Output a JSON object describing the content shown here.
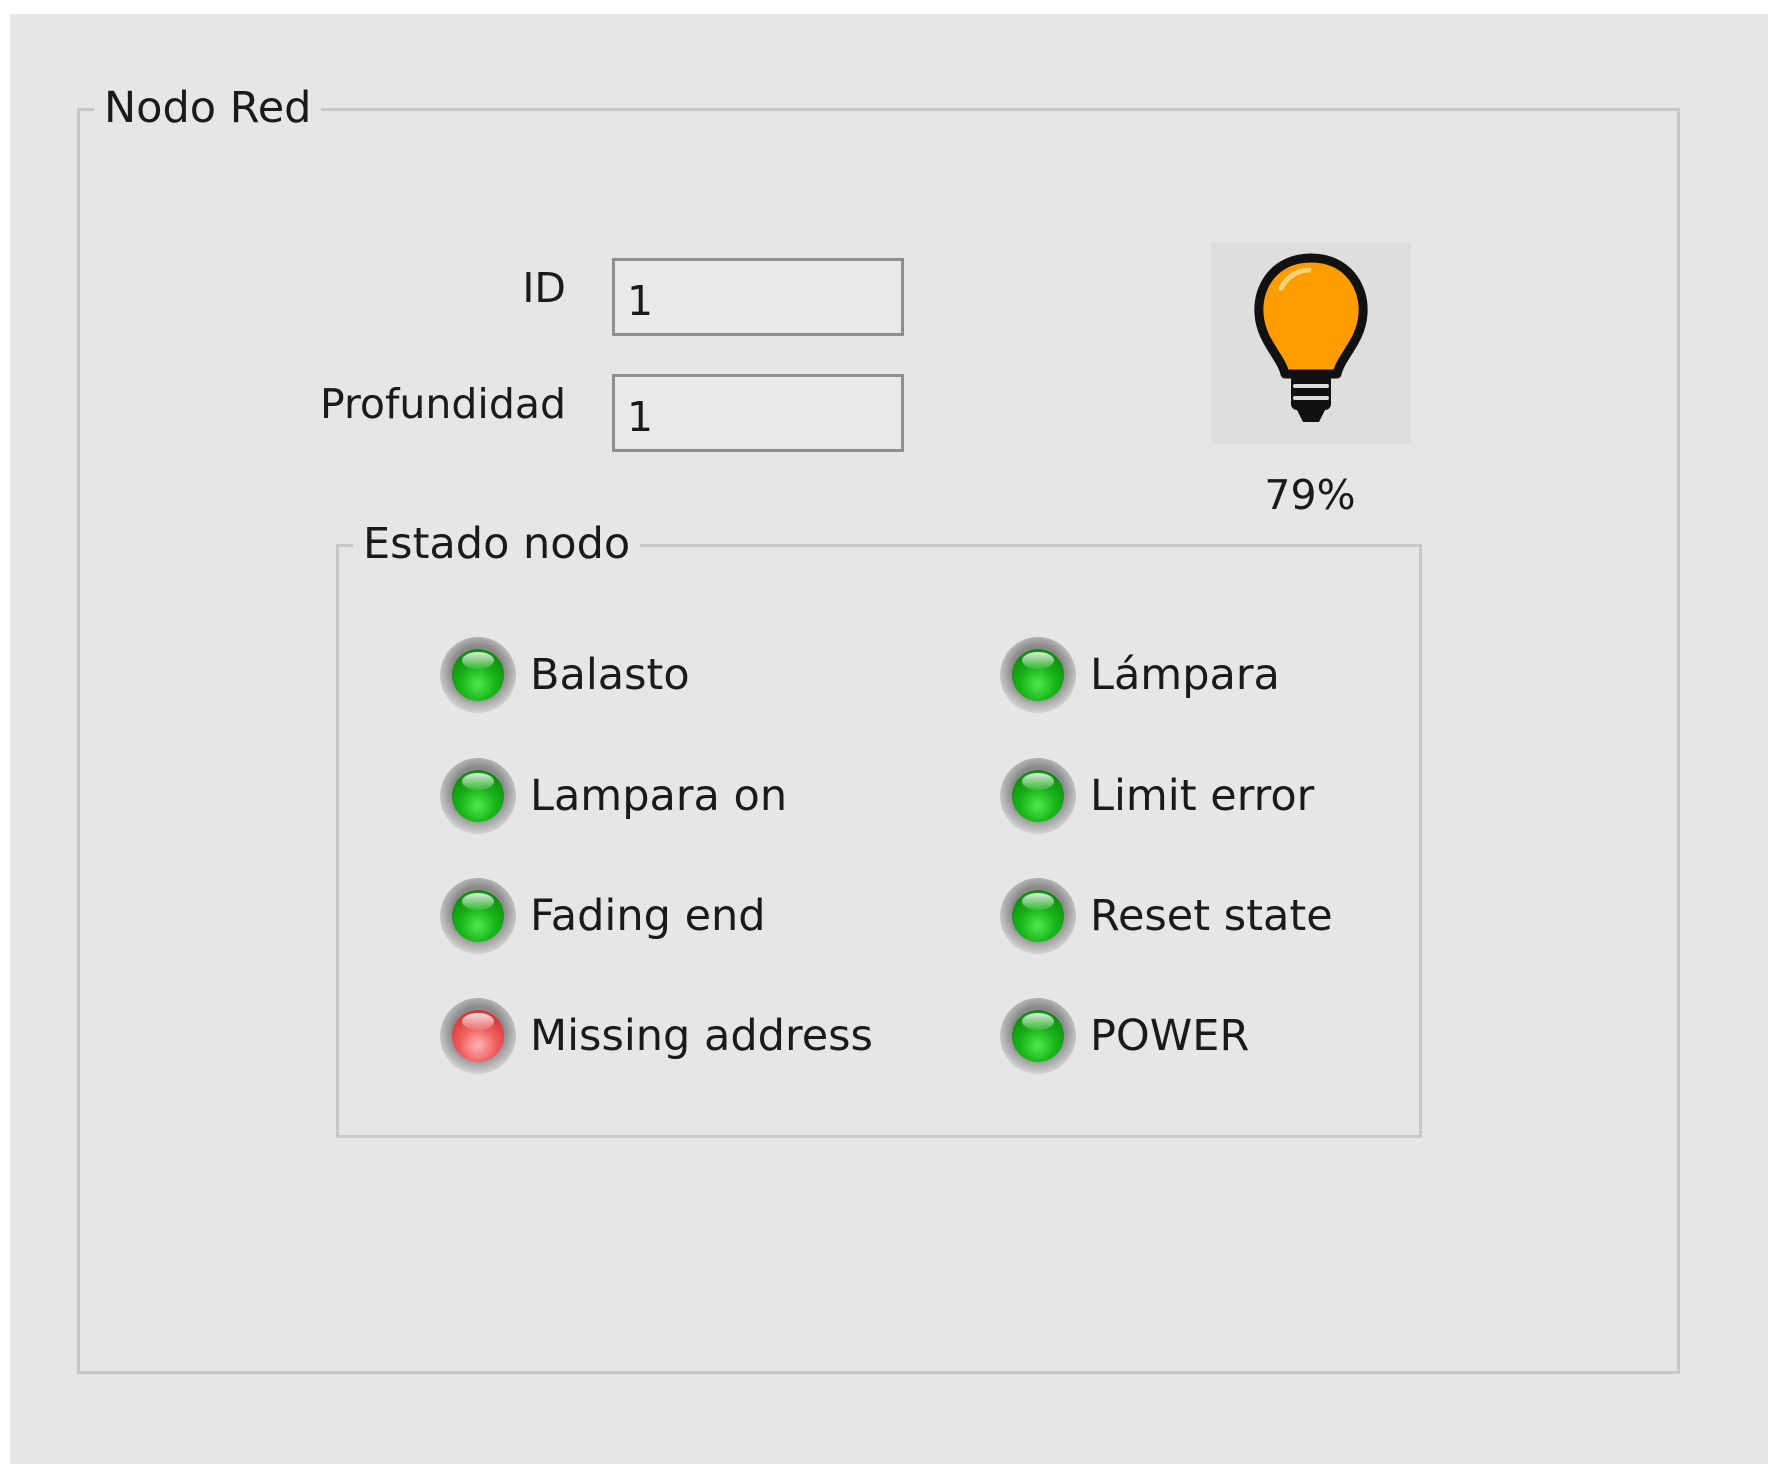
{
  "group_title": "Nodo Red",
  "fields": {
    "id_label": "ID",
    "id_value": "1",
    "depth_label": "Profundidad",
    "depth_value": "1"
  },
  "lamp": {
    "icon": "light-bulb-icon",
    "color": "#ff9c00",
    "percent_text": "79%"
  },
  "estado": {
    "title": "Estado nodo",
    "indicators": [
      {
        "label": "Balasto",
        "state": "green"
      },
      {
        "label": "Lámpara",
        "state": "green"
      },
      {
        "label": "Lampara on",
        "state": "green"
      },
      {
        "label": "Limit error",
        "state": "green"
      },
      {
        "label": "Fading end",
        "state": "green"
      },
      {
        "label": "Reset state",
        "state": "green"
      },
      {
        "label": "Missing address",
        "state": "red"
      },
      {
        "label": "POWER",
        "state": "green"
      }
    ]
  },
  "colors": {
    "background": "#e6e6e6",
    "led_on": "#19b419",
    "led_error": "#e84848"
  }
}
